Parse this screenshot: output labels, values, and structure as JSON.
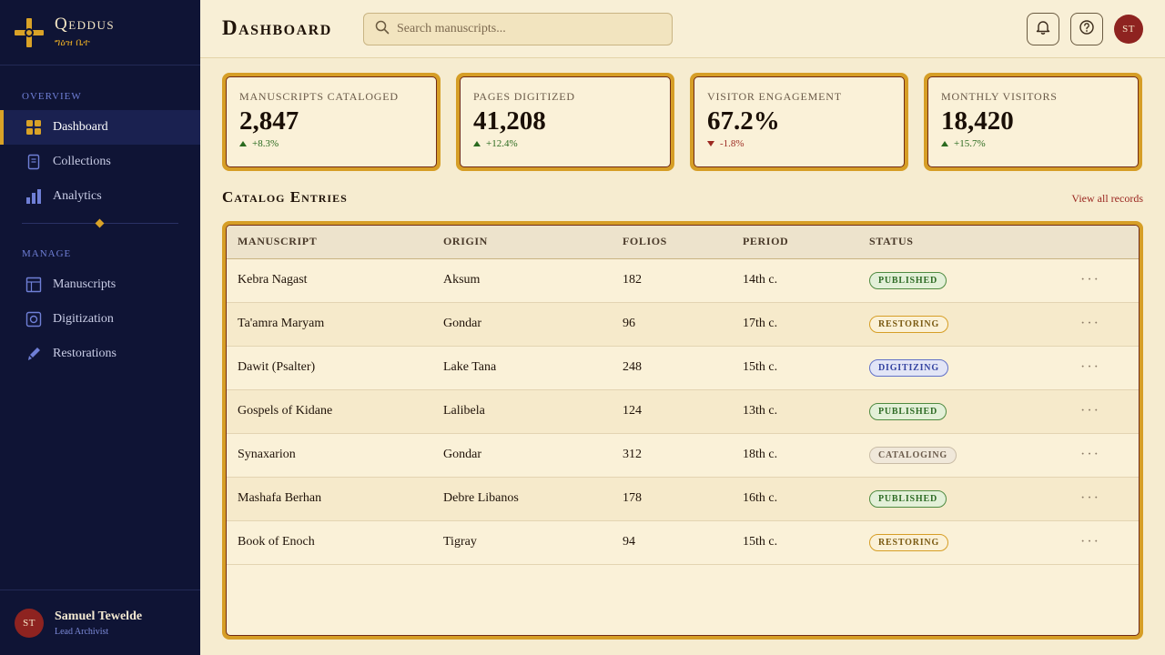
{
  "brand": {
    "name": "Qeddus",
    "sub": "ግዕዝ ቤተ"
  },
  "nav": {
    "sections": [
      {
        "label": "Overview"
      },
      {
        "label": "Manage"
      }
    ],
    "items": [
      {
        "label": "Dashboard",
        "icon": "grid-icon",
        "active": true
      },
      {
        "label": "Collections",
        "icon": "book-icon"
      },
      {
        "label": "Analytics",
        "icon": "bar-chart-icon"
      },
      {
        "label": "Manuscripts",
        "icon": "layout-icon"
      },
      {
        "label": "Digitization",
        "icon": "camera-icon"
      },
      {
        "label": "Restorations",
        "icon": "brush-icon"
      }
    ]
  },
  "user": {
    "initials": "ST",
    "name": "Samuel Tewelde",
    "role": "Lead Archivist"
  },
  "header": {
    "title": "Dashboard",
    "search_placeholder": "Search manuscripts..."
  },
  "kpis": [
    {
      "label": "Manuscripts Cataloged",
      "value": "2,847",
      "delta": "+8.3%",
      "trend": "up"
    },
    {
      "label": "Pages Digitized",
      "value": "41,208",
      "delta": "+12.4%",
      "trend": "up"
    },
    {
      "label": "Visitor Engagement",
      "value": "67.2%",
      "delta": "-1.8%",
      "trend": "down"
    },
    {
      "label": "Monthly Visitors",
      "value": "18,420",
      "delta": "+15.7%",
      "trend": "up"
    }
  ],
  "catalog": {
    "title": "Catalog Entries",
    "view_all": "View all records",
    "columns": [
      "Manuscript",
      "Origin",
      "Folios",
      "Period",
      "Status"
    ],
    "rows": [
      {
        "manuscript": "Kebra Nagast",
        "origin": "Aksum",
        "folios": "182",
        "period": "14th c.",
        "status": "Published"
      },
      {
        "manuscript": "Ta'amra Maryam",
        "origin": "Gondar",
        "folios": "96",
        "period": "17th c.",
        "status": "Restoring"
      },
      {
        "manuscript": "Dawit (Psalter)",
        "origin": "Lake Tana",
        "folios": "248",
        "period": "15th c.",
        "status": "Digitizing"
      },
      {
        "manuscript": "Gospels of Kidane",
        "origin": "Lalibela",
        "folios": "124",
        "period": "13th c.",
        "status": "Published"
      },
      {
        "manuscript": "Synaxarion",
        "origin": "Gondar",
        "folios": "312",
        "period": "18th c.",
        "status": "Cataloging"
      },
      {
        "manuscript": "Mashafa Berhan",
        "origin": "Debre Libanos",
        "folios": "178",
        "period": "16th c.",
        "status": "Published"
      },
      {
        "manuscript": "Book of Enoch",
        "origin": "Tigray",
        "folios": "94",
        "period": "15th c.",
        "status": "Restoring"
      }
    ],
    "more_glyph": "···"
  },
  "colors": {
    "sidebar": "#0f1435",
    "gold": "#d69e26",
    "parchment": "#faf1d8",
    "crimson": "#8e2320"
  }
}
